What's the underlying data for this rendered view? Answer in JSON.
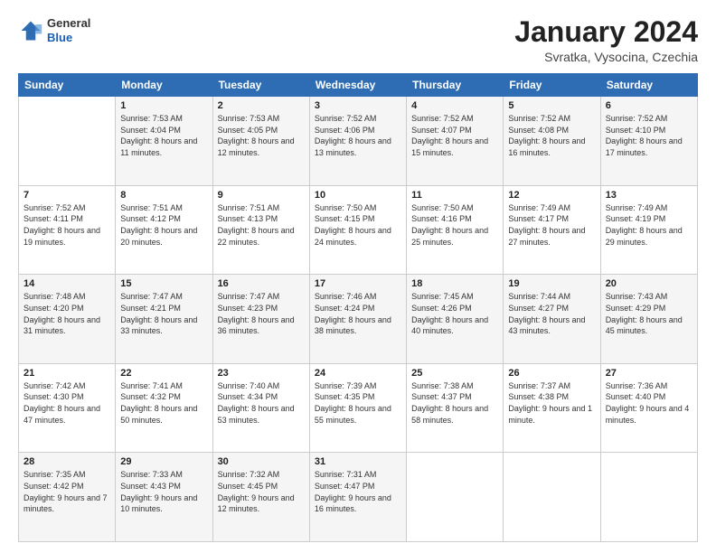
{
  "header": {
    "logo": {
      "general": "General",
      "blue": "Blue"
    },
    "title": "January 2024",
    "subtitle": "Svratka, Vysocina, Czechia"
  },
  "calendar": {
    "weekdays": [
      "Sunday",
      "Monday",
      "Tuesday",
      "Wednesday",
      "Thursday",
      "Friday",
      "Saturday"
    ],
    "weeks": [
      [
        {
          "day": "",
          "sunrise": "",
          "sunset": "",
          "daylight": ""
        },
        {
          "day": "1",
          "sunrise": "Sunrise: 7:53 AM",
          "sunset": "Sunset: 4:04 PM",
          "daylight": "Daylight: 8 hours and 11 minutes."
        },
        {
          "day": "2",
          "sunrise": "Sunrise: 7:53 AM",
          "sunset": "Sunset: 4:05 PM",
          "daylight": "Daylight: 8 hours and 12 minutes."
        },
        {
          "day": "3",
          "sunrise": "Sunrise: 7:52 AM",
          "sunset": "Sunset: 4:06 PM",
          "daylight": "Daylight: 8 hours and 13 minutes."
        },
        {
          "day": "4",
          "sunrise": "Sunrise: 7:52 AM",
          "sunset": "Sunset: 4:07 PM",
          "daylight": "Daylight: 8 hours and 15 minutes."
        },
        {
          "day": "5",
          "sunrise": "Sunrise: 7:52 AM",
          "sunset": "Sunset: 4:08 PM",
          "daylight": "Daylight: 8 hours and 16 minutes."
        },
        {
          "day": "6",
          "sunrise": "Sunrise: 7:52 AM",
          "sunset": "Sunset: 4:10 PM",
          "daylight": "Daylight: 8 hours and 17 minutes."
        }
      ],
      [
        {
          "day": "7",
          "sunrise": "Sunrise: 7:52 AM",
          "sunset": "Sunset: 4:11 PM",
          "daylight": "Daylight: 8 hours and 19 minutes."
        },
        {
          "day": "8",
          "sunrise": "Sunrise: 7:51 AM",
          "sunset": "Sunset: 4:12 PM",
          "daylight": "Daylight: 8 hours and 20 minutes."
        },
        {
          "day": "9",
          "sunrise": "Sunrise: 7:51 AM",
          "sunset": "Sunset: 4:13 PM",
          "daylight": "Daylight: 8 hours and 22 minutes."
        },
        {
          "day": "10",
          "sunrise": "Sunrise: 7:50 AM",
          "sunset": "Sunset: 4:15 PM",
          "daylight": "Daylight: 8 hours and 24 minutes."
        },
        {
          "day": "11",
          "sunrise": "Sunrise: 7:50 AM",
          "sunset": "Sunset: 4:16 PM",
          "daylight": "Daylight: 8 hours and 25 minutes."
        },
        {
          "day": "12",
          "sunrise": "Sunrise: 7:49 AM",
          "sunset": "Sunset: 4:17 PM",
          "daylight": "Daylight: 8 hours and 27 minutes."
        },
        {
          "day": "13",
          "sunrise": "Sunrise: 7:49 AM",
          "sunset": "Sunset: 4:19 PM",
          "daylight": "Daylight: 8 hours and 29 minutes."
        }
      ],
      [
        {
          "day": "14",
          "sunrise": "Sunrise: 7:48 AM",
          "sunset": "Sunset: 4:20 PM",
          "daylight": "Daylight: 8 hours and 31 minutes."
        },
        {
          "day": "15",
          "sunrise": "Sunrise: 7:47 AM",
          "sunset": "Sunset: 4:21 PM",
          "daylight": "Daylight: 8 hours and 33 minutes."
        },
        {
          "day": "16",
          "sunrise": "Sunrise: 7:47 AM",
          "sunset": "Sunset: 4:23 PM",
          "daylight": "Daylight: 8 hours and 36 minutes."
        },
        {
          "day": "17",
          "sunrise": "Sunrise: 7:46 AM",
          "sunset": "Sunset: 4:24 PM",
          "daylight": "Daylight: 8 hours and 38 minutes."
        },
        {
          "day": "18",
          "sunrise": "Sunrise: 7:45 AM",
          "sunset": "Sunset: 4:26 PM",
          "daylight": "Daylight: 8 hours and 40 minutes."
        },
        {
          "day": "19",
          "sunrise": "Sunrise: 7:44 AM",
          "sunset": "Sunset: 4:27 PM",
          "daylight": "Daylight: 8 hours and 43 minutes."
        },
        {
          "day": "20",
          "sunrise": "Sunrise: 7:43 AM",
          "sunset": "Sunset: 4:29 PM",
          "daylight": "Daylight: 8 hours and 45 minutes."
        }
      ],
      [
        {
          "day": "21",
          "sunrise": "Sunrise: 7:42 AM",
          "sunset": "Sunset: 4:30 PM",
          "daylight": "Daylight: 8 hours and 47 minutes."
        },
        {
          "day": "22",
          "sunrise": "Sunrise: 7:41 AM",
          "sunset": "Sunset: 4:32 PM",
          "daylight": "Daylight: 8 hours and 50 minutes."
        },
        {
          "day": "23",
          "sunrise": "Sunrise: 7:40 AM",
          "sunset": "Sunset: 4:34 PM",
          "daylight": "Daylight: 8 hours and 53 minutes."
        },
        {
          "day": "24",
          "sunrise": "Sunrise: 7:39 AM",
          "sunset": "Sunset: 4:35 PM",
          "daylight": "Daylight: 8 hours and 55 minutes."
        },
        {
          "day": "25",
          "sunrise": "Sunrise: 7:38 AM",
          "sunset": "Sunset: 4:37 PM",
          "daylight": "Daylight: 8 hours and 58 minutes."
        },
        {
          "day": "26",
          "sunrise": "Sunrise: 7:37 AM",
          "sunset": "Sunset: 4:38 PM",
          "daylight": "Daylight: 9 hours and 1 minute."
        },
        {
          "day": "27",
          "sunrise": "Sunrise: 7:36 AM",
          "sunset": "Sunset: 4:40 PM",
          "daylight": "Daylight: 9 hours and 4 minutes."
        }
      ],
      [
        {
          "day": "28",
          "sunrise": "Sunrise: 7:35 AM",
          "sunset": "Sunset: 4:42 PM",
          "daylight": "Daylight: 9 hours and 7 minutes."
        },
        {
          "day": "29",
          "sunrise": "Sunrise: 7:33 AM",
          "sunset": "Sunset: 4:43 PM",
          "daylight": "Daylight: 9 hours and 10 minutes."
        },
        {
          "day": "30",
          "sunrise": "Sunrise: 7:32 AM",
          "sunset": "Sunset: 4:45 PM",
          "daylight": "Daylight: 9 hours and 12 minutes."
        },
        {
          "day": "31",
          "sunrise": "Sunrise: 7:31 AM",
          "sunset": "Sunset: 4:47 PM",
          "daylight": "Daylight: 9 hours and 16 minutes."
        },
        {
          "day": "",
          "sunrise": "",
          "sunset": "",
          "daylight": ""
        },
        {
          "day": "",
          "sunrise": "",
          "sunset": "",
          "daylight": ""
        },
        {
          "day": "",
          "sunrise": "",
          "sunset": "",
          "daylight": ""
        }
      ]
    ]
  }
}
